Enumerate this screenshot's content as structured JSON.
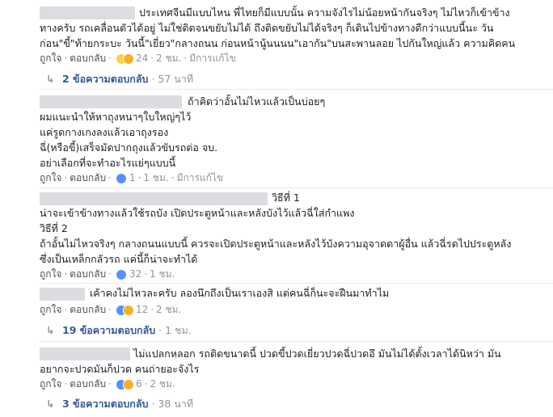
{
  "comments": [
    {
      "lines": [
        "ประเทศจีนมีแบบไหน พี่ไทยก็มีแบบนั้น ความจังไรไม่น้อยหน้ากันจริงๆ ไม่ไหวก็เข้าข้าง",
        "ทางครับ รถเคลื่อนตัวได้อยู่ ไม่ใช่ติดจนขยับไม่ได้ ถึงติดขยับไม่ได้จริงๆ ก็เดินไปข้างทางดีกว่าแบบนี้นะ วัน",
        "ก่อน\"ขี้\"ท้ายกระบะ วันนี้\"เยี่ยว\"กลางถนน ก่อนหน้านู้นนนน\"เอากัน\"บนสะพานลอย ไปกันใหญ่แล้ว ความคิดคน"
      ],
      "actions": {
        "like": "ถูกใจ",
        "reply": "ตอบกลับ",
        "count": "24",
        "time": "2 ชม.",
        "edited": "มีการแก้ไข"
      },
      "replies_label": "2 ข้อความตอบกลับ",
      "replies_time": "57 นาที"
    },
    {
      "lines": [
        "ถ้าคิดว่าอั้นไม่ไหวแล้วเป็นบ่อยๆ",
        "ผมแนะนำให้หาถุงหนาๆใบใหญ่ๆไว้",
        "แค่รูดกางเกงลงแล้วเอาถุงรอง",
        "ฉี่(หรือขี้)เสร็จมัดปากถุงแล้วขับรถต่อ จบ.",
        "อย่าเลือกที่จะทำอะไรแย่ๆแบบนี้"
      ],
      "actions": {
        "like": "ถูกใจ",
        "reply": "ตอบกลับ",
        "count": "1",
        "time": "1 ชม.",
        "edited": "มีการแก้ไข"
      }
    },
    {
      "lines": [
        "วิธีที่ 1",
        "น่าจะเข้าข้างทางแล้วใช้รถบัง เปิดประตูหน้าและหลังบังไว้แล้วฉี่ใส่กำแพง",
        "วิธีที่ 2",
        "ถ้าอั้นไม่ไหวจริงๆ กลางถนนแบบนี้ ควรจะเปิดประตูหน้าและหลังไว้บังความอุจาดตาผู้อื่น แล้วฉี่รดไปประตูหลัง",
        "ซึ่งเป็นเหล็กกลัวรถ แค่นี้ก็น่าจะทำได้"
      ],
      "actions": {
        "like": "ถูกใจ",
        "reply": "ตอบกลับ",
        "count": "32",
        "time": "1 ชม."
      }
    },
    {
      "lines": [
        "เค้าคงไม่ไหวละครับ ลองนึกถึงเป็นเราเองสิ แต่คนฉี่ก็นะจะฝืนมาทำไม"
      ],
      "actions": {
        "like": "ถูกใจ",
        "reply": "ตอบกลับ",
        "count": "12",
        "time": "2 ชม."
      },
      "replies_label": "19 ข้อความตอบกลับ",
      "replies_time": "1 ชม."
    },
    {
      "lines": [
        "ไม่แปลกหลอก รถติดขนาดนี้ ปวดขี้ปวดเยี่ยวปวดฉี่ปวดอึ มันไม่ได้ตั้งเวลาได้นิหว่า มัน",
        "อยากจะปวดมันก็ปวด คนถ่ายอะจังไร"
      ],
      "actions": {
        "like": "ถูกใจ",
        "reply": "ตอบกลับ",
        "count": "6",
        "time": "2 ชม."
      },
      "replies_label": "3 ข้อความตอบกลับ",
      "replies_time": "38 นาที"
    }
  ]
}
